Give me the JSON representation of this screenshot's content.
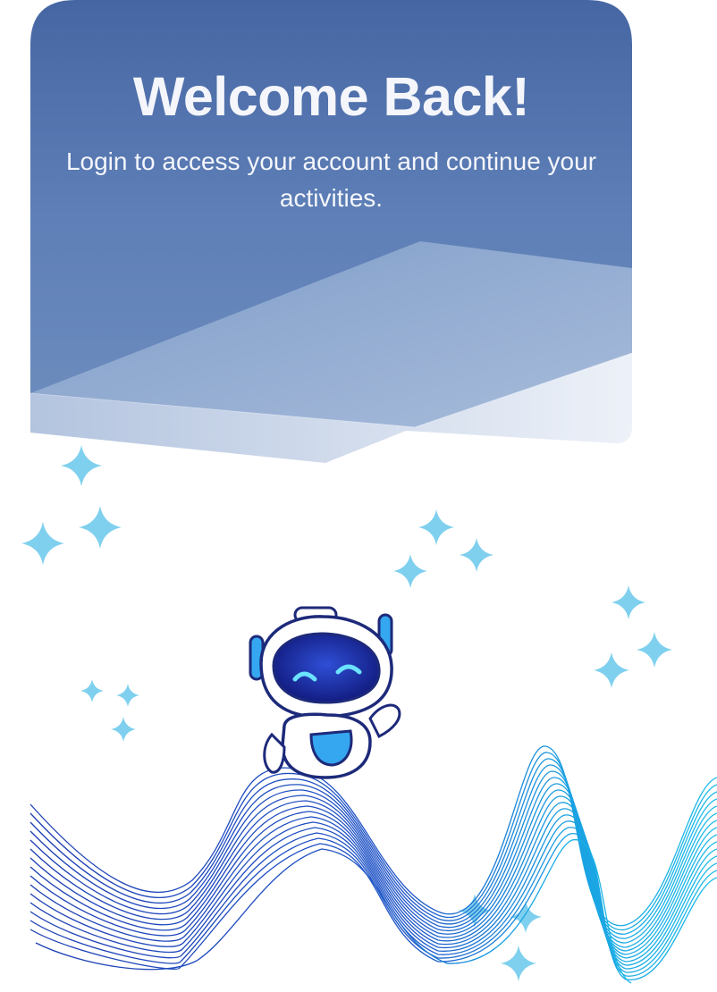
{
  "welcome": {
    "title": "Welcome Back!",
    "subtitle": "Login to access your account and continue your activities."
  },
  "illustration": {
    "subject": "robot-mascot-icon",
    "decorations": [
      "sparkle-star-icon",
      "wave-lines-graphic"
    ]
  },
  "colors": {
    "hero_top": "#4666a3",
    "hero_mid": "#6a8abc",
    "hero_bottom": "#e8eef7",
    "title_text": "#f4f6fb",
    "star": "#7fd0ee",
    "wave_left": "#1d3fb3",
    "wave_right": "#1bbbe8",
    "robot_visor": "#1a2a9a",
    "robot_accent": "#35a7f0"
  }
}
